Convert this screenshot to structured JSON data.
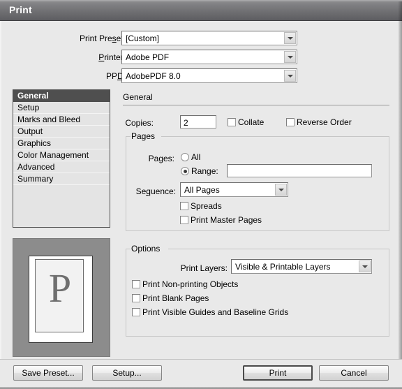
{
  "window": {
    "title": "Print"
  },
  "top_settings": [
    {
      "label_pre": "Print Pre",
      "label_acc": "s",
      "label_post": "et:",
      "value": "[Custom]"
    },
    {
      "label_pre": "",
      "label_acc": "P",
      "label_post": "rinter:",
      "value": "Adobe PDF"
    },
    {
      "label_pre": "PP",
      "label_acc": "D",
      "label_post": ":",
      "value": "AdobePDF 8.0"
    }
  ],
  "sidebar": {
    "items": [
      {
        "label": "General",
        "selected": true
      },
      {
        "label": "Setup",
        "selected": false
      },
      {
        "label": "Marks and Bleed",
        "selected": false
      },
      {
        "label": "Output",
        "selected": false
      },
      {
        "label": "Graphics",
        "selected": false
      },
      {
        "label": "Color Management",
        "selected": false
      },
      {
        "label": "Advanced",
        "selected": false
      },
      {
        "label": "Summary",
        "selected": false
      }
    ]
  },
  "preview": {
    "letter": "P"
  },
  "pane": {
    "title": "General",
    "copies": {
      "label": "Copies:",
      "value": "2"
    },
    "collate": {
      "label": "Collate",
      "checked": false
    },
    "reverse_order": {
      "label": "Reverse Order",
      "checked": false
    },
    "pages_group": {
      "label": "Pages",
      "pages_label": "Pages:",
      "all_option": {
        "label": "All",
        "selected": false
      },
      "range_option": {
        "label": "Range:",
        "selected": true
      },
      "range_value": "",
      "sequence": {
        "label_pre": "Se",
        "label_acc": "q",
        "label_post": "uence:",
        "value": "All Pages"
      },
      "spreads": {
        "label": "Spreads",
        "checked": false
      },
      "print_master_pages": {
        "label": "Print Master Pages",
        "checked": false
      }
    },
    "options_group": {
      "label": "Options",
      "print_layers": {
        "label": "Print Layers:",
        "value": "Visible & Printable Layers"
      },
      "print_nonprinting": {
        "label": "Print Non-printing Objects",
        "checked": false
      },
      "print_blank_pages": {
        "label": "Print Blank Pages",
        "checked": false
      },
      "print_visible_guides": {
        "label": "Print Visible Guides and Baseline Grids",
        "checked": false
      }
    }
  },
  "footer": {
    "save_preset": "Save Preset...",
    "setup": "Setup...",
    "print": "Print",
    "cancel": "Cancel"
  },
  "colors": {
    "titlebar": "#6e6e71",
    "dialog_bg": "#e9e9e9",
    "selected_nav": "#4f4f4f",
    "preview_bg": "#8c8c8c"
  }
}
